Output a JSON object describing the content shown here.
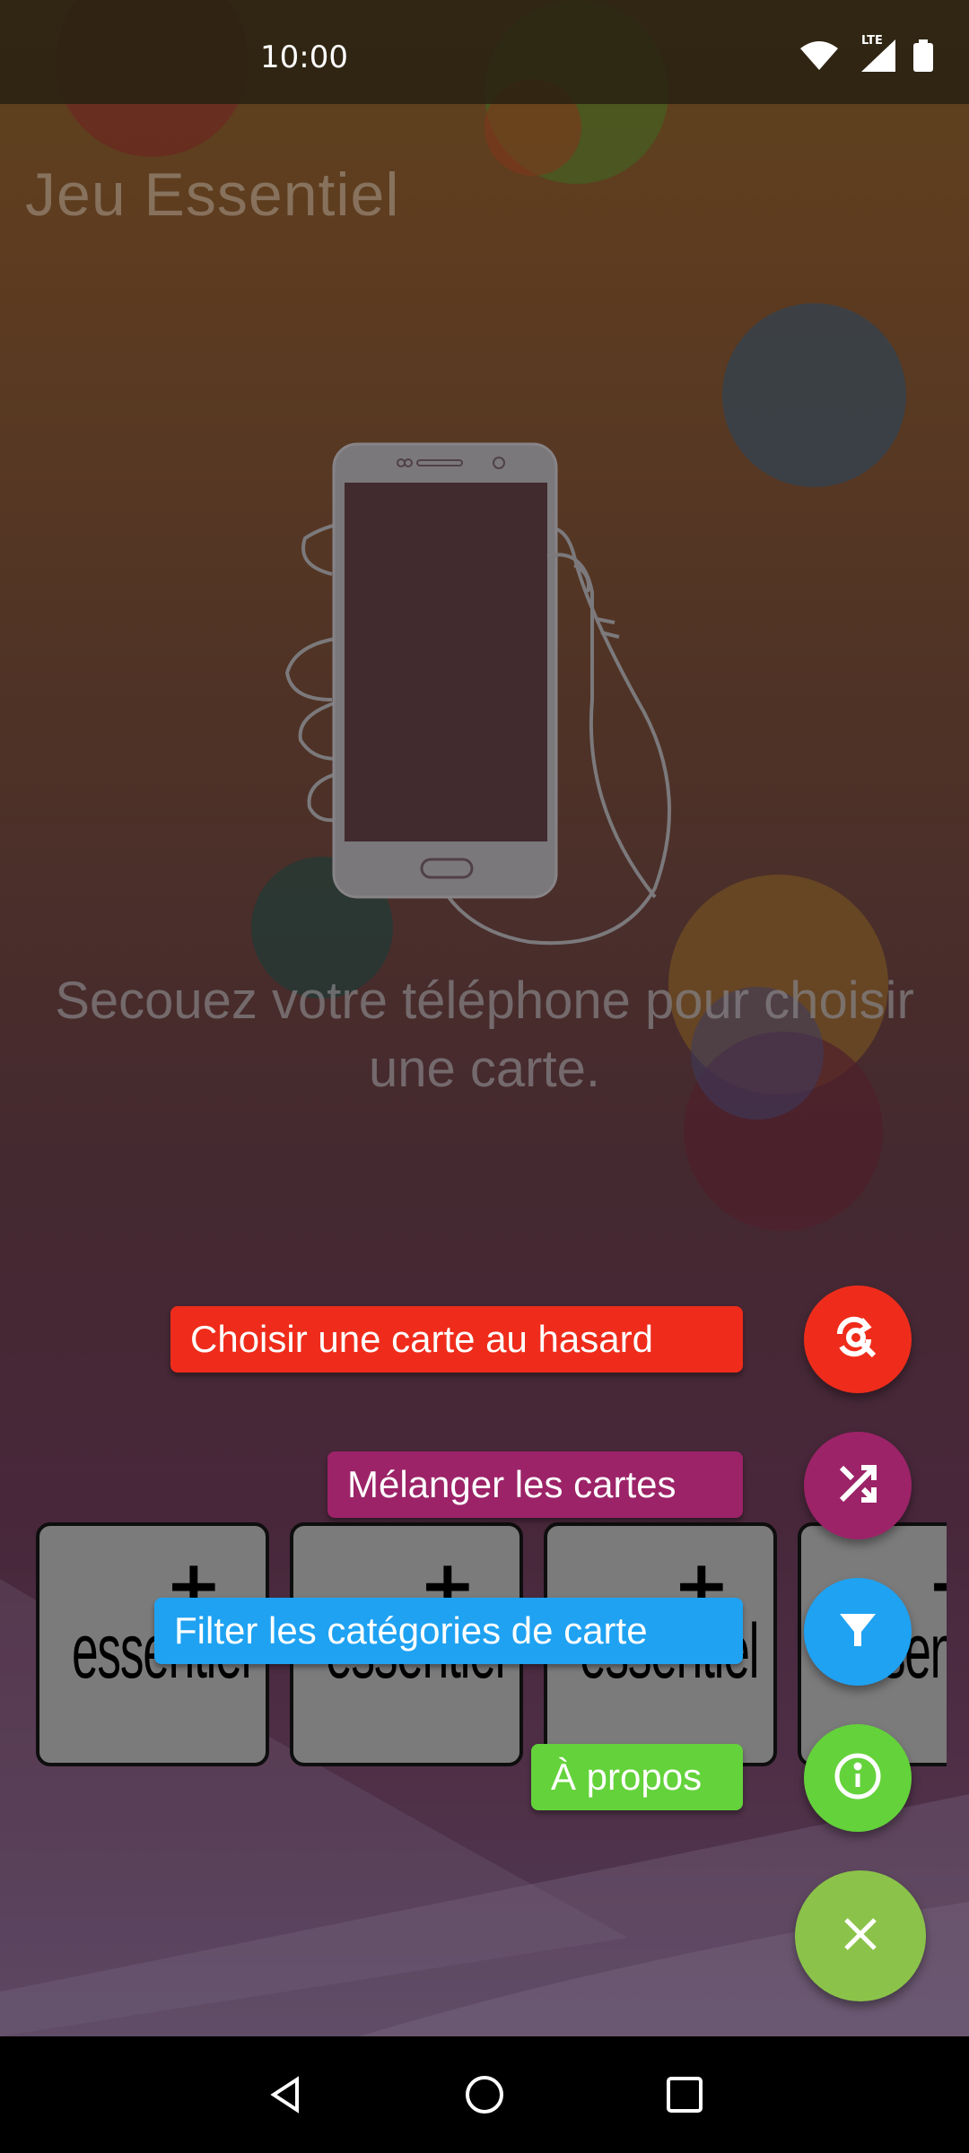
{
  "status_bar": {
    "time": "10:00",
    "network": "LTE"
  },
  "app": {
    "title": "Jeu Essentiel"
  },
  "main": {
    "instruction": "Secouez votre téléphone pour choisir une carte."
  },
  "cards": [
    {
      "symbol": "+",
      "word": "essentiel"
    },
    {
      "symbol": "+",
      "word": "essentiel"
    },
    {
      "symbol": "+",
      "word": "essentiel"
    },
    {
      "symbol": "+",
      "word": "essentiel"
    }
  ],
  "fab_menu": {
    "random_label": "Choisir une carte au hasard",
    "shuffle_label": "Mélanger les cartes",
    "filter_label": "Filter les catégories de carte",
    "about_label": "À propos"
  },
  "colors": {
    "random": "#ef2c1b",
    "shuffle": "#9c2368",
    "filter": "#1fa2f2",
    "about": "#64d23b",
    "close": "#8bc34a"
  },
  "icons": {
    "random": "search-refresh-icon",
    "shuffle": "shuffle-icon",
    "filter": "filter-icon",
    "about": "info-icon",
    "close": "close-icon"
  }
}
